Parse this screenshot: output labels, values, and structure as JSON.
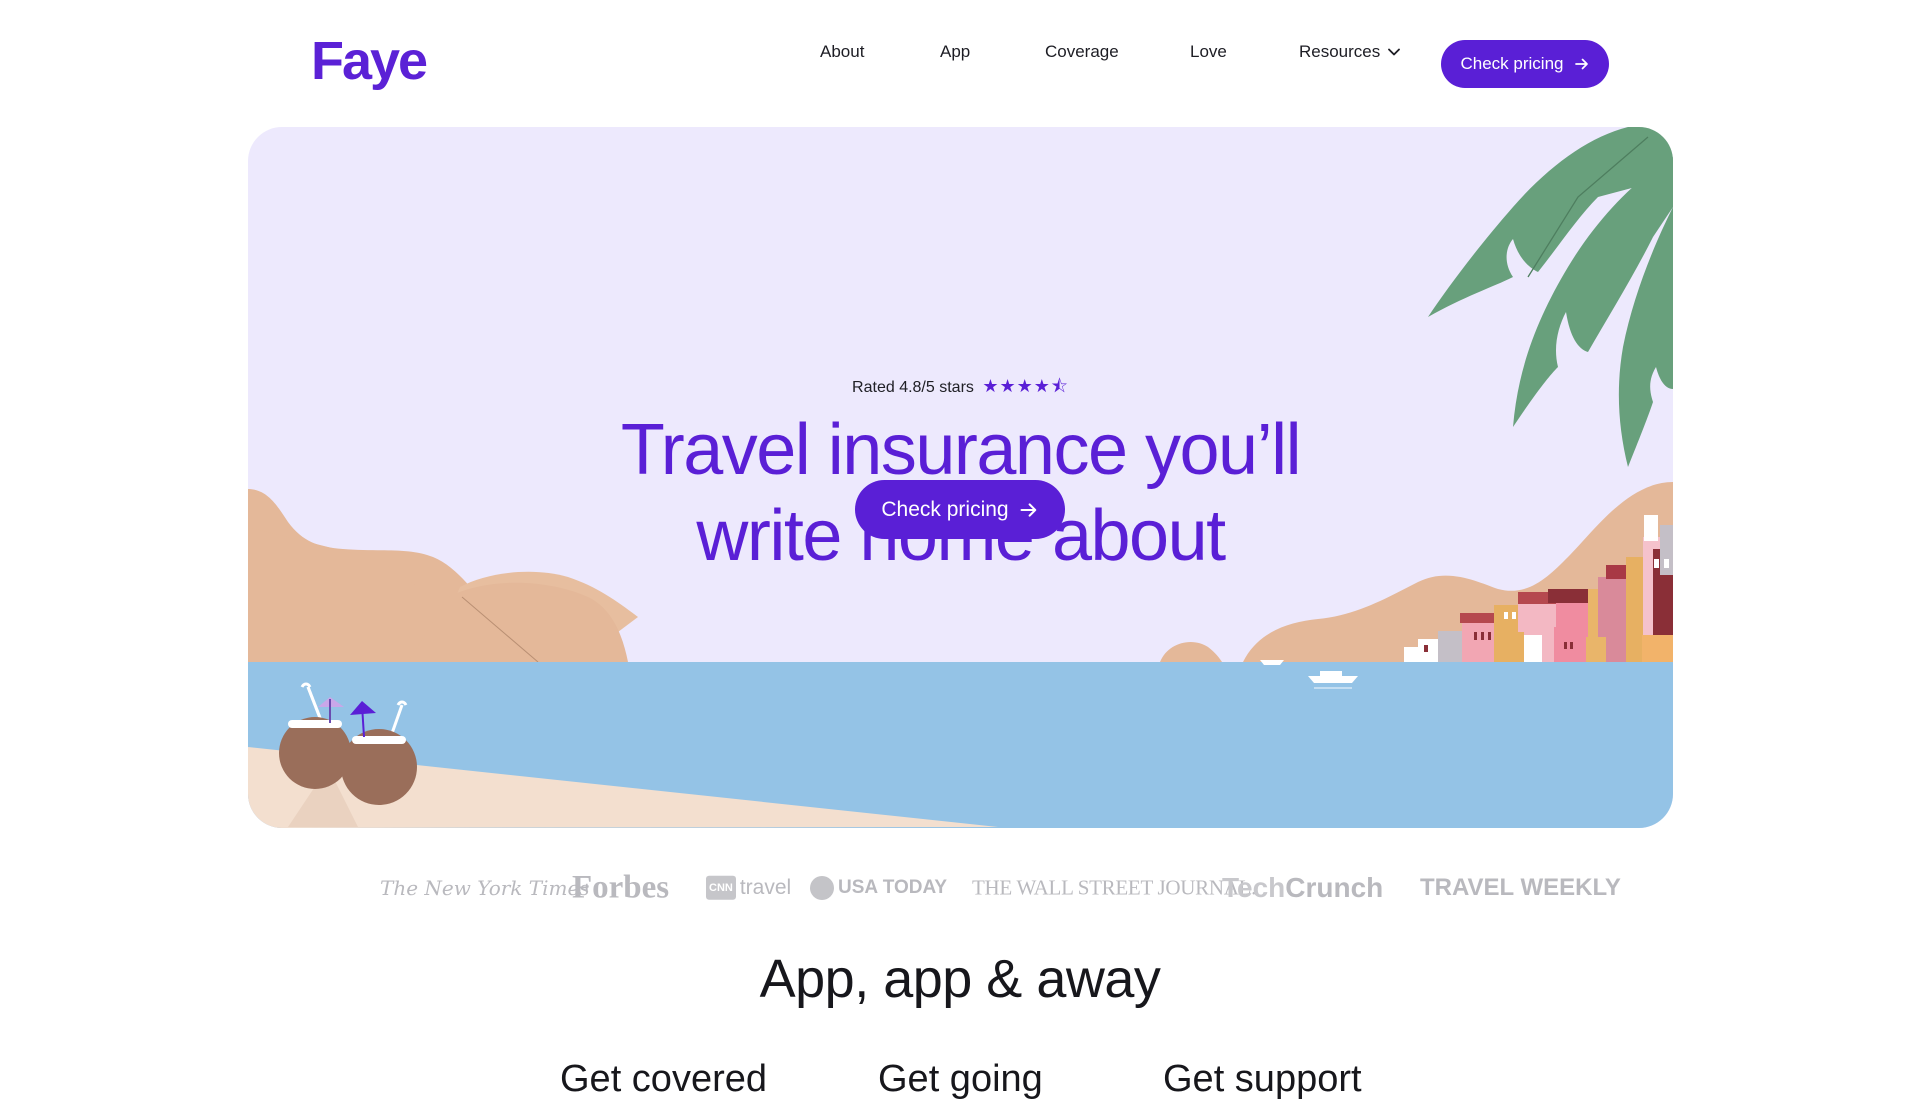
{
  "header": {
    "logo": "Faye",
    "nav": [
      {
        "label": "About"
      },
      {
        "label": "App"
      },
      {
        "label": "Coverage"
      },
      {
        "label": "Love"
      },
      {
        "label": "Resources"
      }
    ],
    "cta_label": "Check pricing"
  },
  "hero": {
    "rating_text": "Rated 4.8/5 stars",
    "rating_value": 4.8,
    "rating_max": 5,
    "title_line1": "Travel insurance you’ll",
    "title_line2": "write home about",
    "cta_label": "Check pricing"
  },
  "press": {
    "nyt": "The New York Times",
    "forbes": "Forbes",
    "cnn_mark": "CNN",
    "cnn_word": "travel",
    "usa": "USA TODAY",
    "wsj": "THE WALL STREET JOURNAL.",
    "tc_a": "Tech",
    "tc_b": "Crunch",
    "tw": "TRAVEL WEEKLY"
  },
  "section": {
    "title": "App, app & away",
    "subheads": [
      "Get covered",
      "Get going",
      "Get support"
    ]
  },
  "colors": {
    "brand": "#5a1fd6",
    "hero_bg": "#ede9fd",
    "sea": "#94c3e6",
    "sand": "#f3dfcf",
    "hills": "#e4b899",
    "palm": "#68a07c"
  },
  "icons": {
    "arrow": "arrow-right-icon",
    "chevron": "chevron-down-icon",
    "star": "star-icon"
  }
}
